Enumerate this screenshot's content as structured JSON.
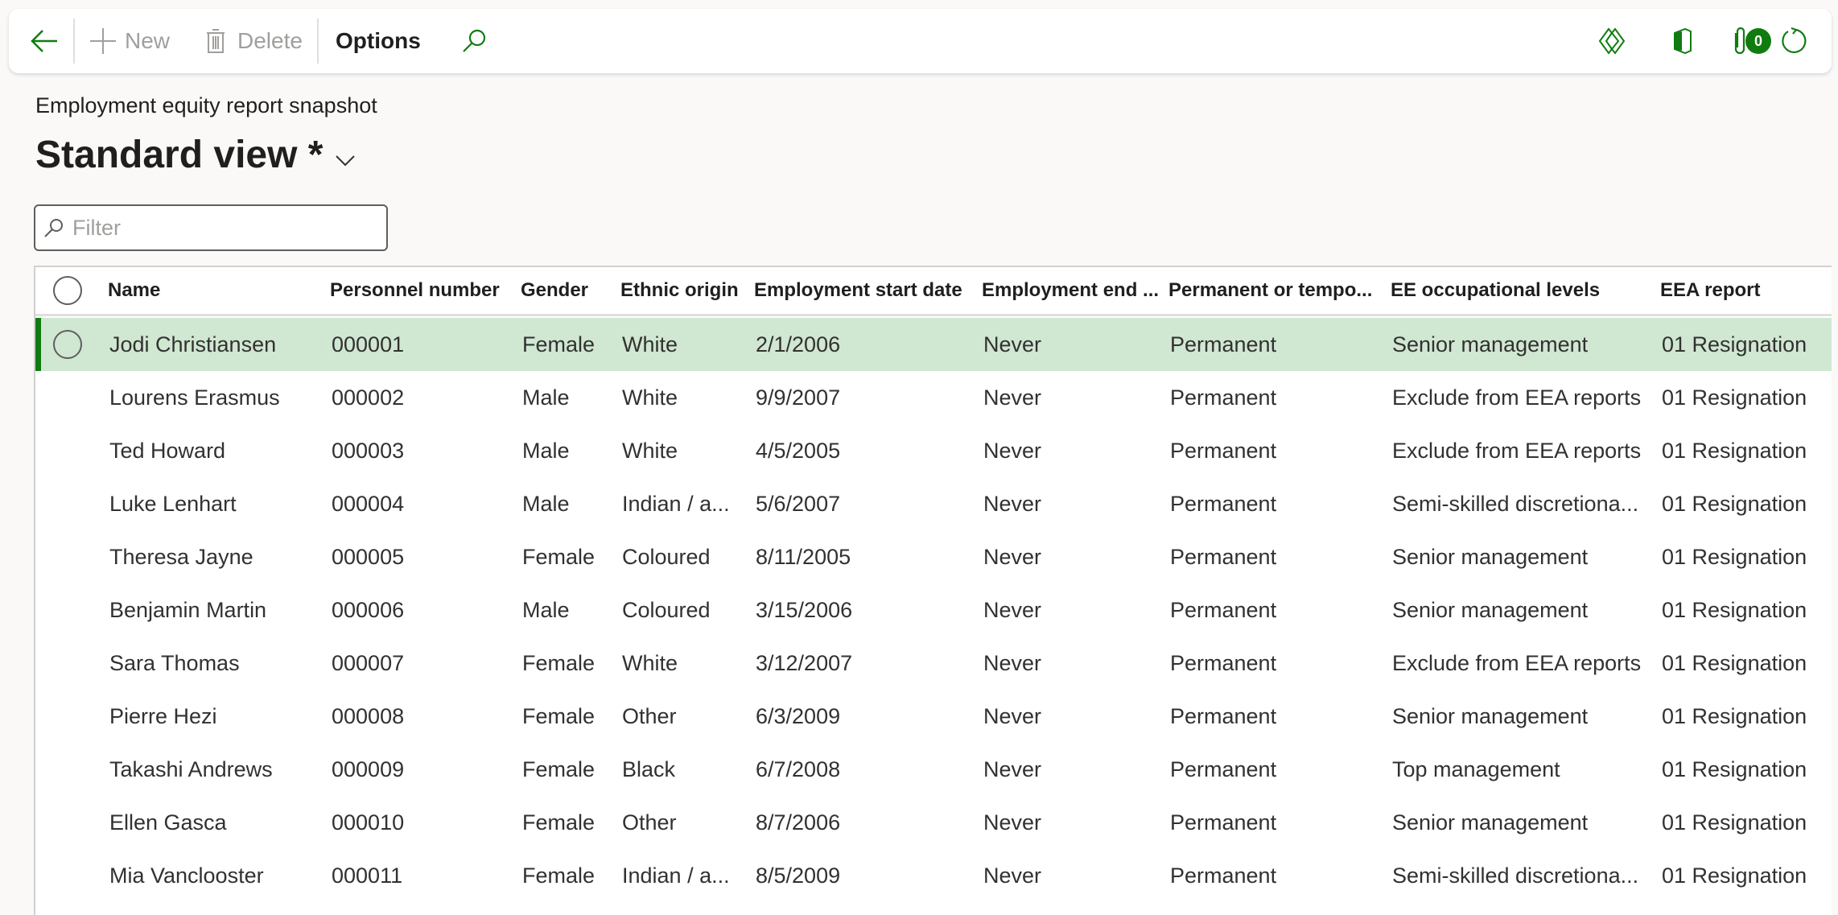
{
  "toolbar": {
    "back_label": "Back",
    "new_label": "New",
    "delete_label": "Delete",
    "options_label": "Options",
    "attachments_count": "0",
    "accent_color": "#107c10"
  },
  "header": {
    "breadcrumb": "Employment equity report snapshot",
    "view_title": "Standard view *"
  },
  "filter": {
    "placeholder": "Filter",
    "value": ""
  },
  "grid": {
    "columns": [
      "Name",
      "Personnel number",
      "Gender",
      "Ethnic origin",
      "Employment start date",
      "Employment end ...",
      "Permanent or tempo...",
      "EE occupational levels",
      "EEA report"
    ],
    "selected_row": 0,
    "rows": [
      [
        "Jodi Christiansen",
        "000001",
        "Female",
        "White",
        "2/1/2006",
        "Never",
        "Permanent",
        "Senior management",
        "01 Resignation"
      ],
      [
        "Lourens Erasmus",
        "000002",
        "Male",
        "White",
        "9/9/2007",
        "Never",
        "Permanent",
        "Exclude from EEA reports",
        "01 Resignation"
      ],
      [
        "Ted Howard",
        "000003",
        "Male",
        "White",
        "4/5/2005",
        "Never",
        "Permanent",
        "Exclude from EEA reports",
        "01 Resignation"
      ],
      [
        "Luke Lenhart",
        "000004",
        "Male",
        "Indian / a...",
        "5/6/2007",
        "Never",
        "Permanent",
        "Semi-skilled discretiona...",
        "01 Resignation"
      ],
      [
        "Theresa Jayne",
        "000005",
        "Female",
        "Coloured",
        "8/11/2005",
        "Never",
        "Permanent",
        "Senior management",
        "01 Resignation"
      ],
      [
        "Benjamin Martin",
        "000006",
        "Male",
        "Coloured",
        "3/15/2006",
        "Never",
        "Permanent",
        "Senior management",
        "01 Resignation"
      ],
      [
        "Sara Thomas",
        "000007",
        "Female",
        "White",
        "3/12/2007",
        "Never",
        "Permanent",
        "Exclude from EEA reports",
        "01 Resignation"
      ],
      [
        "Pierre Hezi",
        "000008",
        "Female",
        "Other",
        "6/3/2009",
        "Never",
        "Permanent",
        "Senior management",
        "01 Resignation"
      ],
      [
        "Takashi Andrews",
        "000009",
        "Female",
        "Black",
        "6/7/2008",
        "Never",
        "Permanent",
        "Top management",
        "01 Resignation"
      ],
      [
        "Ellen Gasca",
        "000010",
        "Female",
        "Other",
        "8/7/2006",
        "Never",
        "Permanent",
        "Senior management",
        "01 Resignation"
      ],
      [
        "Mia Vanclooster",
        "000011",
        "Female",
        "Indian / a...",
        "8/5/2009",
        "Never",
        "Permanent",
        "Semi-skilled discretiona...",
        "01 Resignation"
      ]
    ]
  }
}
